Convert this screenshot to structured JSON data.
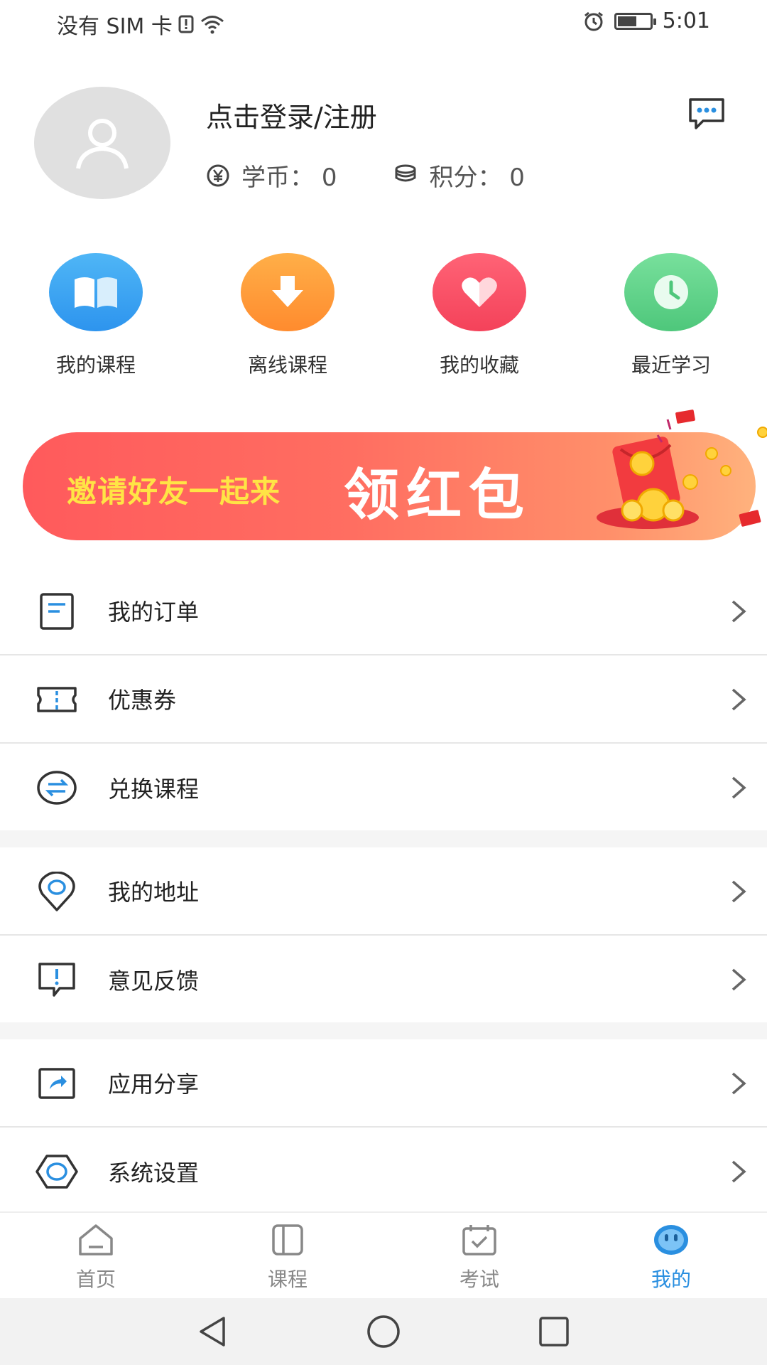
{
  "status_bar": {
    "carrier": "没有 SIM 卡",
    "time": "5:01",
    "battery_level": 0.6
  },
  "profile": {
    "login_text": "点击登录/注册",
    "coins_label": "学币：",
    "coins_value": "0",
    "points_label": "积分：",
    "points_value": "0"
  },
  "quick_actions": [
    {
      "label": "我的课程",
      "icon": "book-icon",
      "color": "#3aa4f2"
    },
    {
      "label": "离线课程",
      "icon": "download-icon",
      "color": "#ff9f3c"
    },
    {
      "label": "我的收藏",
      "icon": "heart-icon",
      "color": "#ff5066"
    },
    {
      "label": "最近学习",
      "icon": "clock-icon",
      "color": "#5fd68a"
    }
  ],
  "banner": {
    "subtitle": "邀请好友一起来",
    "title": "领红包"
  },
  "menu": {
    "group1": [
      {
        "label": "我的订单",
        "icon": "order-icon"
      },
      {
        "label": "优惠券",
        "icon": "coupon-icon"
      },
      {
        "label": "兑换课程",
        "icon": "exchange-icon"
      }
    ],
    "group2": [
      {
        "label": "我的地址",
        "icon": "location-icon"
      },
      {
        "label": "意见反馈",
        "icon": "feedback-icon"
      }
    ],
    "group3": [
      {
        "label": "应用分享",
        "icon": "share-icon"
      },
      {
        "label": "系统设置",
        "icon": "settings-icon"
      }
    ]
  },
  "tabs": [
    {
      "label": "首页",
      "icon": "home-icon",
      "active": false
    },
    {
      "label": "课程",
      "icon": "course-icon",
      "active": false
    },
    {
      "label": "考试",
      "icon": "exam-icon",
      "active": false
    },
    {
      "label": "我的",
      "icon": "me-icon",
      "active": true
    }
  ],
  "colors": {
    "accent": "#2a8fe0",
    "icon_stroke": "#333333"
  }
}
